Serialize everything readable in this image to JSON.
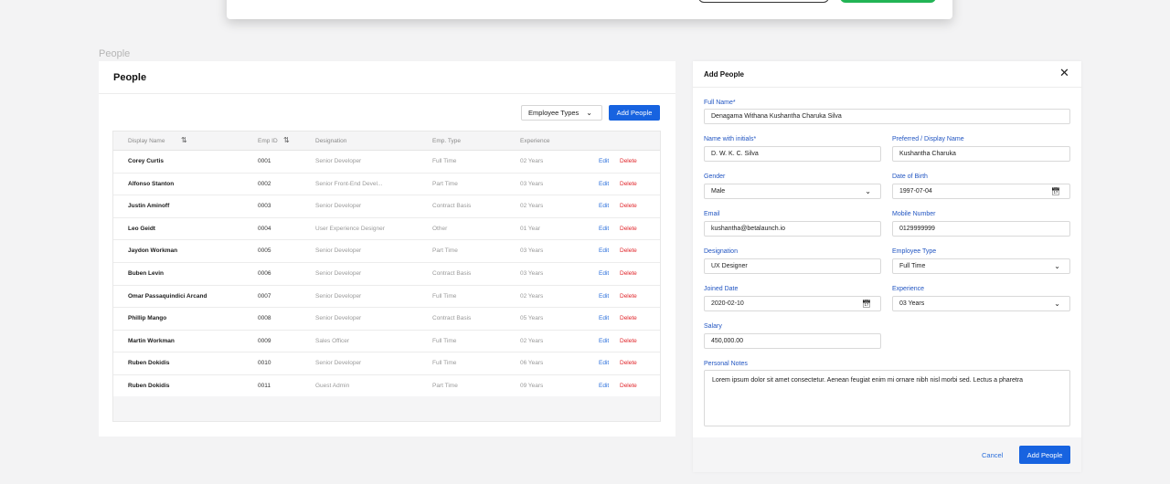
{
  "breadcrumb": "People",
  "people_panel": {
    "title": "People",
    "employee_types_label": "Employee Types",
    "add_button": "Add People",
    "columns": [
      "Display Name",
      "Emp ID",
      "Designation",
      "Emp. Type",
      "Experience"
    ],
    "rows": [
      {
        "name": "Corey Curtis",
        "id": "0001",
        "designation": "Senior Developer",
        "type": "Full Time",
        "experience": "02 Years"
      },
      {
        "name": "Alfonso Stanton",
        "id": "0002",
        "designation": "Senior Front-End Devel...",
        "type": "Part Time",
        "experience": "03 Years"
      },
      {
        "name": "Justin Aminoff",
        "id": "0003",
        "designation": "Senior Developer",
        "type": "Contract Basis",
        "experience": "02 Years"
      },
      {
        "name": "Leo Geidt",
        "id": "0004",
        "designation": "User Experience Designer",
        "type": "Other",
        "experience": "01 Year"
      },
      {
        "name": "Jaydon Workman",
        "id": "0005",
        "designation": "Senior Developer",
        "type": "Part Time",
        "experience": "03 Years"
      },
      {
        "name": "Buben Levin",
        "id": "0006",
        "designation": "Senior Developer",
        "type": "Contract Basis",
        "experience": "03 Years"
      },
      {
        "name": "Omar Passaquindici Arcand",
        "id": "0007",
        "designation": "Senior Developer",
        "type": "Full Time",
        "experience": "02 Years"
      },
      {
        "name": "Phillip Mango",
        "id": "0008",
        "designation": "Senior Developer",
        "type": "Contract Basis",
        "experience": "05 Years"
      },
      {
        "name": "Martin Workman",
        "id": "0009",
        "designation": "Sales Officer",
        "type": "Full Time",
        "experience": "02 Years"
      },
      {
        "name": "Ruben Dokidis",
        "id": "0010",
        "designation": "Senior Developer",
        "type": "Full Time",
        "experience": "06 Years"
      },
      {
        "name": "Ruben Dokidis",
        "id": "0011",
        "designation": "Guest Admin",
        "type": "Part Time",
        "experience": "09 Years"
      }
    ],
    "edit_label": "Edit",
    "delete_label": "Delete"
  },
  "add_panel": {
    "title": "Add People",
    "full_name_label": "Full Name*",
    "full_name": "Denagama Withana Kushantha Charuka Silva",
    "initials_label": "Name with initials*",
    "initials": "D. W. K. C. Silva",
    "display_label": "Preferred / Display Name",
    "display": "Kushantha Charuka",
    "gender_label": "Gender",
    "gender": "Male",
    "dob_label": "Date of Birth",
    "dob": "1997-07-04",
    "email_label": "Email",
    "email": "kushantha@betalaunch.io",
    "mobile_label": "Mobile Number",
    "mobile": "0129999999",
    "designation_label": "Designation",
    "designation": "UX Designer",
    "emp_type_label": "Employee Type",
    "emp_type": "Full Time",
    "joined_label": "Joined Date",
    "joined": "2020-02-10",
    "experience_label": "Experience",
    "experience": "03 Years",
    "salary_label": "Salary",
    "salary": "450,000.00",
    "notes_label": "Personal Notes",
    "notes": "Lorem ipsum dolor sit amet consectetur. Aenean feugiat enim mi ornare nibh nisl morbi sed. Lectus a pharetra",
    "cancel": "Cancel",
    "submit": "Add People"
  }
}
